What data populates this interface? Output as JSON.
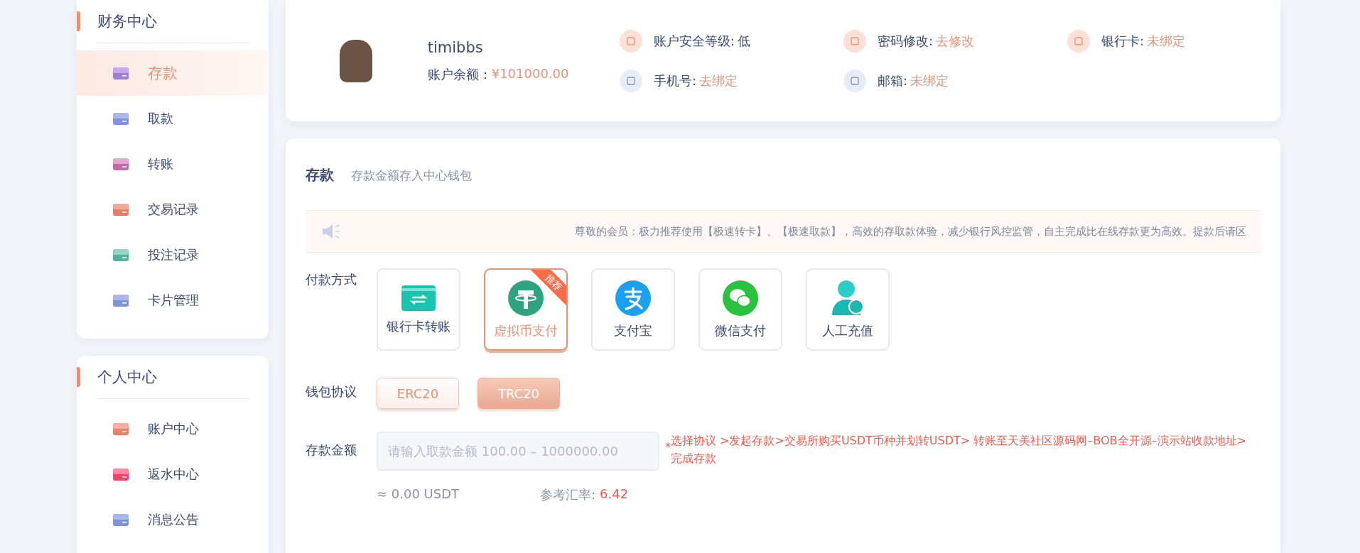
{
  "sidebar": {
    "groups": [
      {
        "title": "财务中心",
        "items": [
          {
            "label": "存款",
            "selected": true
          },
          {
            "label": "取款",
            "selected": false
          },
          {
            "label": "转账",
            "selected": false
          },
          {
            "label": "交易记录",
            "selected": false
          },
          {
            "label": "投注记录",
            "selected": false
          },
          {
            "label": "卡片管理",
            "selected": false
          }
        ]
      },
      {
        "title": "个人中心",
        "items": [
          {
            "label": "账户中心",
            "selected": false
          },
          {
            "label": "返水中心",
            "selected": false
          },
          {
            "label": "消息公告",
            "selected": false
          }
        ]
      }
    ]
  },
  "profile": {
    "username": "timibbs",
    "balance_label": "账户余额：",
    "balance": "¥101000.00",
    "info": [
      {
        "label": "账户安全等级:",
        "value": "低",
        "kind": "text"
      },
      {
        "label": "密码修改:",
        "value": "去修改",
        "kind": "link"
      },
      {
        "label": "银行卡:",
        "value": "未绑定",
        "kind": "link"
      },
      {
        "label": "手机号:",
        "value": "去绑定",
        "kind": "link"
      },
      {
        "label": "邮箱:",
        "value": "未绑定",
        "kind": "link"
      }
    ]
  },
  "deposit": {
    "title": "存款",
    "subtitle": "存款金额存入中心钱包",
    "notice": "尊敬的会员：极力推荐使用【极速转卡】、【极速取款】，高效的存取款体验，减少银行风控监管，自主完成比在线存款更为高效。提款后请区",
    "payment_label": "付款方式",
    "payment_methods": [
      {
        "label": "银行卡转账",
        "selected": false
      },
      {
        "label": "虚拟币支付",
        "selected": true,
        "badge": "推荐"
      },
      {
        "label": "支付宝",
        "selected": false
      },
      {
        "label": "微信支付",
        "selected": false
      },
      {
        "label": "人工充值",
        "selected": false
      }
    ],
    "protocol_label": "钱包协议",
    "protocols": [
      {
        "label": "ERC20",
        "selected": false
      },
      {
        "label": "TRC20",
        "selected": true
      }
    ],
    "amount_label": "存款金额",
    "amount_placeholder": "请输入取款金额 100.00 – 1000000.00",
    "hint_mark": "*",
    "hint": "选择协议 >发起存款>交易所购买USDT币种并划转USDT> 转账至天美社区源码网–BOB全开源–演示站收款地址>完成存款",
    "usdt": "≈ 0.00 USDT",
    "rate_label": "参考汇率:",
    "rate": "6.42"
  }
}
